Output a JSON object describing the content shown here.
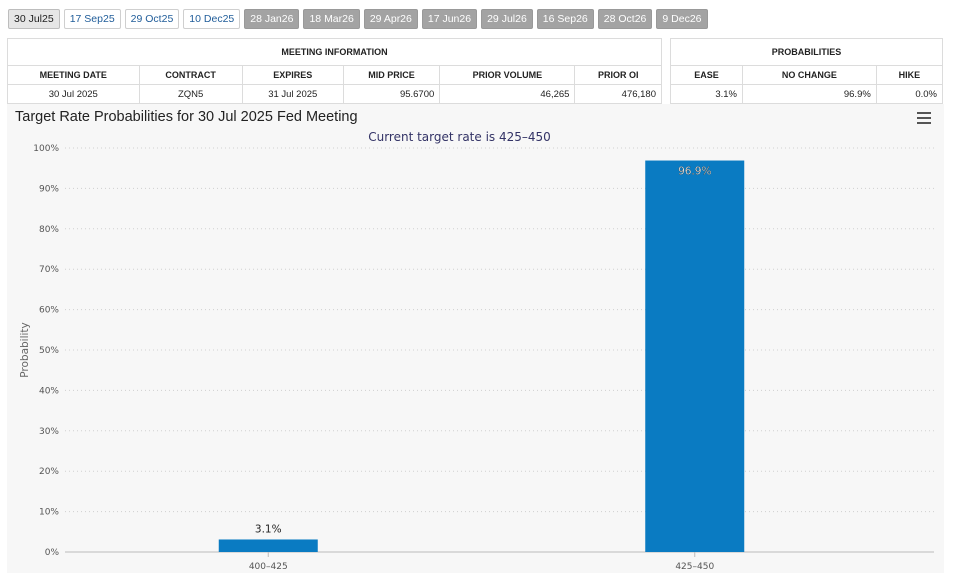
{
  "tabs": [
    {
      "label": "30 Jul25",
      "state": "selected"
    },
    {
      "label": "17 Sep25",
      "state": "normal"
    },
    {
      "label": "29 Oct25",
      "state": "normal"
    },
    {
      "label": "10 Dec25",
      "state": "normal"
    },
    {
      "label": "28 Jan26",
      "state": "disabled"
    },
    {
      "label": "18 Mar26",
      "state": "disabled"
    },
    {
      "label": "29 Apr26",
      "state": "disabled"
    },
    {
      "label": "17 Jun26",
      "state": "disabled"
    },
    {
      "label": "29 Jul26",
      "state": "disabled"
    },
    {
      "label": "16 Sep26",
      "state": "disabled"
    },
    {
      "label": "28 Oct26",
      "state": "disabled"
    },
    {
      "label": "9 Dec26",
      "state": "disabled"
    }
  ],
  "meeting_info": {
    "title": "MEETING INFORMATION",
    "headers": [
      "MEETING DATE",
      "CONTRACT",
      "EXPIRES",
      "MID PRICE",
      "PRIOR VOLUME",
      "PRIOR OI"
    ],
    "row": [
      "30 Jul 2025",
      "ZQN5",
      "31 Jul 2025",
      "95.6700",
      "46,265",
      "476,180"
    ]
  },
  "probabilities": {
    "title": "PROBABILITIES",
    "headers": [
      "EASE",
      "NO CHANGE",
      "HIKE"
    ],
    "row": [
      "3.1%",
      "96.9%",
      "0.0%"
    ]
  },
  "chart": {
    "title": "Target Rate Probabilities for 30 Jul 2025 Fed Meeting"
  },
  "chart_data": {
    "type": "bar",
    "title": "Target Rate Probabilities for 30 Jul 2025 Fed Meeting",
    "subtitle": "Current target rate is 425–450",
    "categories": [
      "400–425",
      "425–450"
    ],
    "values": [
      3.1,
      96.9
    ],
    "data_labels": [
      "3.1%",
      "96.9%"
    ],
    "xlabel": "",
    "ylabel": "Probability",
    "ylim": [
      0,
      100
    ],
    "yticks": [
      "0%",
      "10%",
      "20%",
      "30%",
      "40%",
      "50%",
      "60%",
      "70%",
      "80%",
      "90%",
      "100%"
    ],
    "bar_color": "#0a7bc2",
    "grid": true
  }
}
